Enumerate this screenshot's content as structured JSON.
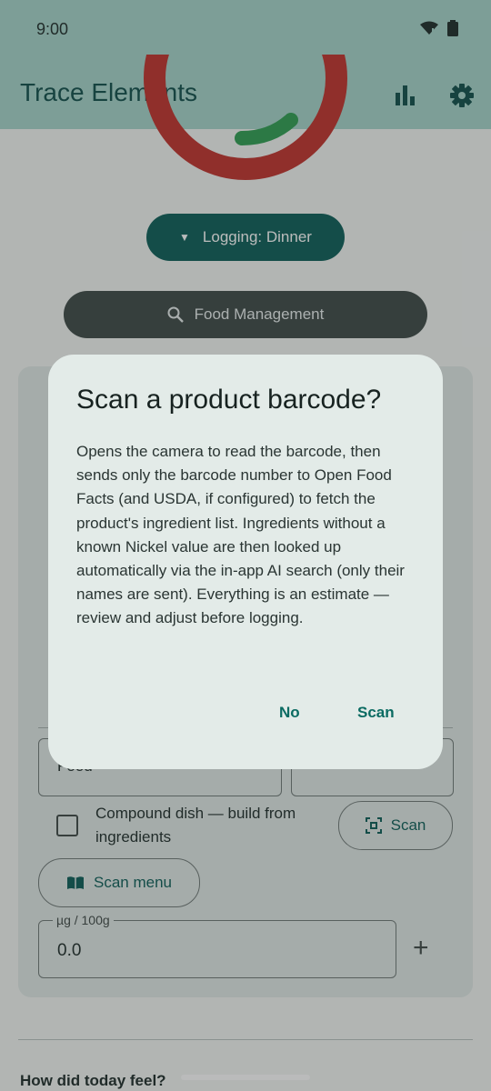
{
  "status": {
    "time": "9:00"
  },
  "app": {
    "title": "Trace Elements"
  },
  "logging": {
    "label": "Logging: Dinner"
  },
  "food_management": {
    "label": "Food Management"
  },
  "form": {
    "food_field": "Food",
    "compound_label": "Compound dish — build from ingredients",
    "scan_label": "Scan",
    "scan_menu_label": "Scan menu",
    "unit_label": "µg / 100g",
    "unit_value": "0.0"
  },
  "footer": {
    "question": "How did today feel?"
  },
  "dialog": {
    "title": "Scan a product barcode?",
    "body": "Opens the camera to read the barcode, then sends only the barcode number to Open Food Facts (and USDA, if configured) to fetch the product's ingredient list. Ingredients without a known Nickel value are then looked up automatically via the in-app AI search (only their names are sent). Everything is an estimate — review and adjust before logging.",
    "no_label": "No",
    "scan_label": "Scan"
  },
  "colors": {
    "accent": "#0b5e57",
    "appbar": "#a6d5ca",
    "ring_red": "#c1312b",
    "ring_green": "#2e9e52"
  },
  "icons": [
    "wifi-icon",
    "battery-icon",
    "bar-chart-icon",
    "gear-icon",
    "dropdown-caret-icon",
    "search-icon",
    "qr-scan-icon",
    "book-icon",
    "plus-icon"
  ]
}
